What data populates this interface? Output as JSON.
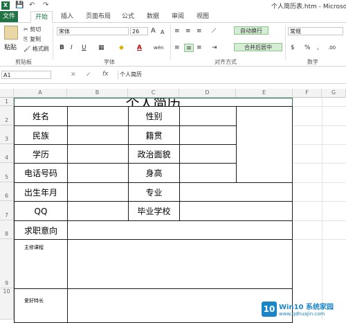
{
  "window": {
    "title": "个人简历表.htm - Microso",
    "app_badge": "X"
  },
  "quick_access": {
    "save": "💾",
    "undo": "↶",
    "redo": "↷"
  },
  "tabs": [
    "文件",
    "开始",
    "插入",
    "页面布局",
    "公式",
    "数据",
    "审阅",
    "视图"
  ],
  "ribbon": {
    "clipboard": {
      "paste": "粘贴",
      "cut": "剪切",
      "copy": "复制",
      "format_painter": "格式刷",
      "group_label": "剪贴板"
    },
    "font": {
      "font_name": "宋体",
      "font_size": "26",
      "grow": "A",
      "shrink": "A",
      "bold": "B",
      "italic": "I",
      "underline": "U",
      "font_color": "A",
      "fill": "◆",
      "phonetic": "wén",
      "group_label": "字体"
    },
    "alignment": {
      "wrap_text": "自动换行",
      "merge_center": "合并后居中",
      "group_label": "对齐方式"
    },
    "number": {
      "format": "常规",
      "percent": "%",
      "comma": ",",
      "group_label": "数字"
    }
  },
  "formula_bar": {
    "name_box": "A1",
    "fx": "fx",
    "content": "个人简历"
  },
  "columns": [
    "A",
    "B",
    "C",
    "D",
    "E",
    "F",
    "G"
  ],
  "rows": [
    "1",
    "2",
    "3",
    "4",
    "5",
    "6",
    "7",
    "8",
    "9",
    "10"
  ],
  "sheet": {
    "title": "个人简历",
    "name": "姓名",
    "gender": "性别",
    "ethnicity": "民族",
    "hometown": "籍贯",
    "education": "学历",
    "politics": "政治面貌",
    "phone": "电话号码",
    "height": "身高",
    "birth": "出生年月",
    "major": "专业",
    "qq": "QQ",
    "school": "毕业学校",
    "job_intent": "求职意向",
    "courses": "主修课程",
    "hobbies": "爱好特长"
  },
  "watermark": {
    "text": "Win10 系统家园",
    "url": "www.qdhuajin.com"
  },
  "colors": {
    "excel_green": "#217346",
    "watermark_blue": "#1a86c8"
  }
}
